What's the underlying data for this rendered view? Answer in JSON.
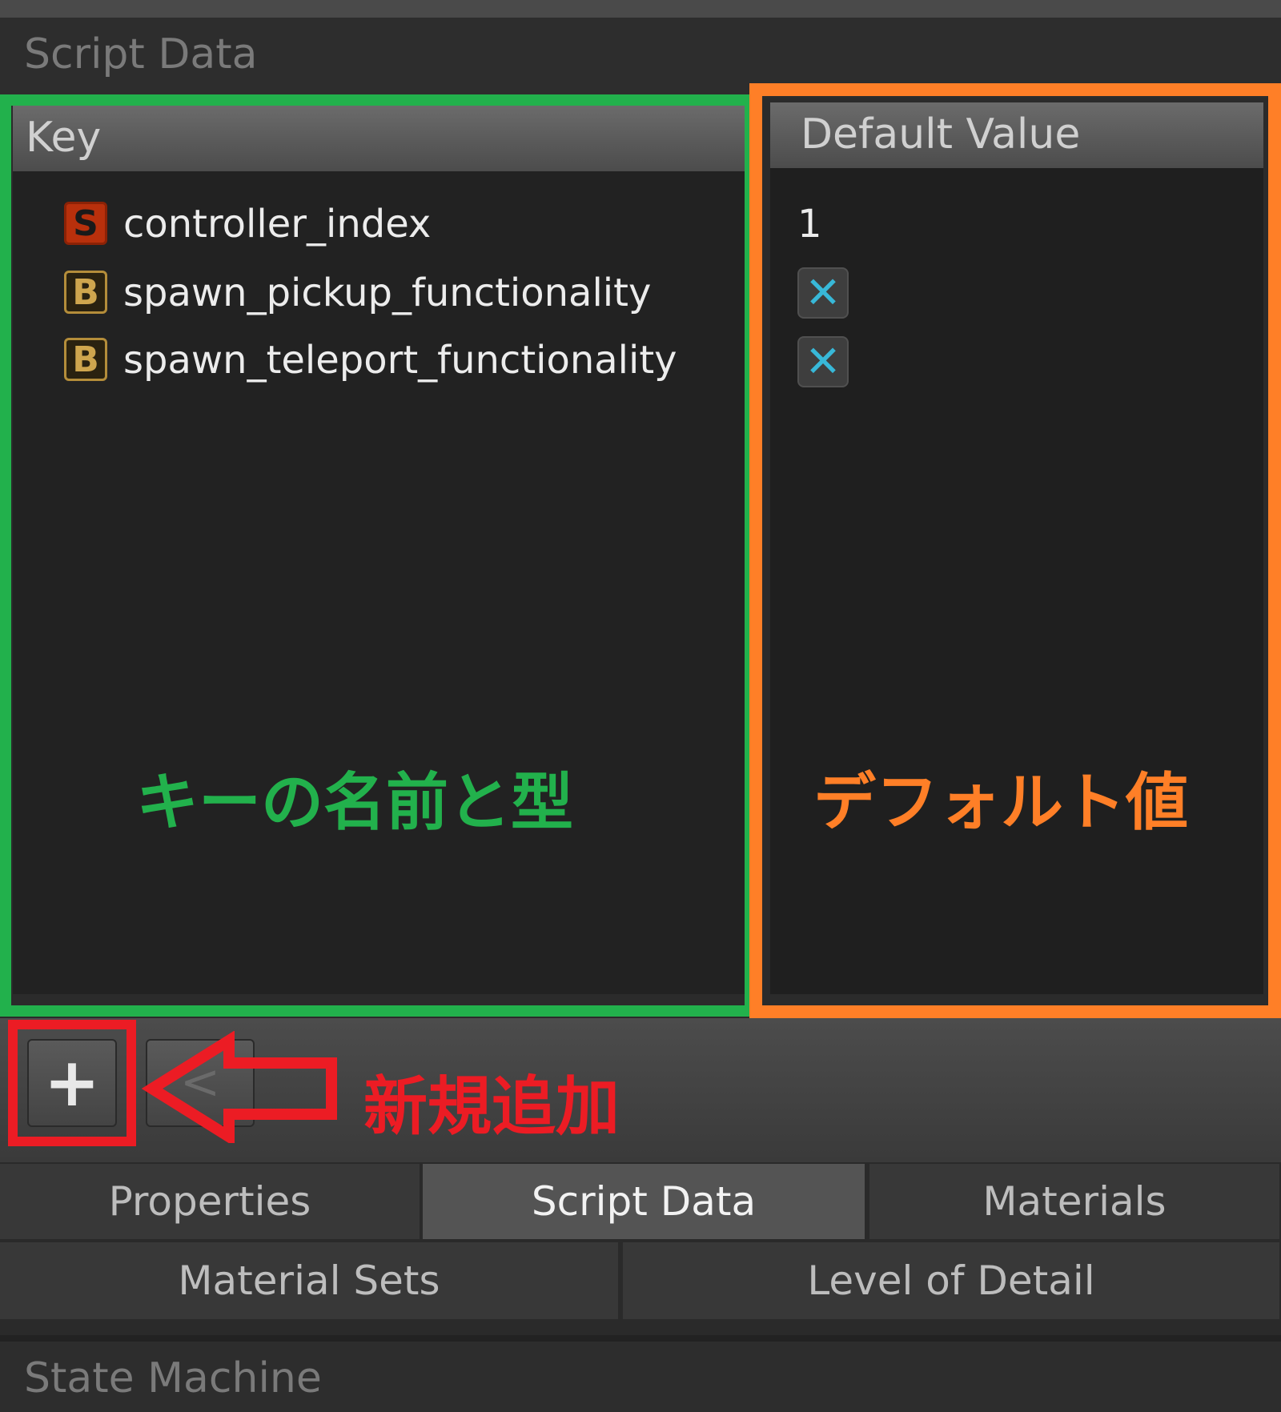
{
  "section": {
    "title": "Script Data"
  },
  "key_column": {
    "header": "Key",
    "rows": [
      {
        "type_letter": "S",
        "name": "controller_index"
      },
      {
        "type_letter": "B",
        "name": "spawn_pickup_functionality"
      },
      {
        "type_letter": "B",
        "name": "spawn_teleport_functionality"
      }
    ]
  },
  "value_column": {
    "header": "Default Value",
    "values": [
      "1",
      "✕",
      "✕"
    ]
  },
  "annotations": {
    "key_label": "キーの名前と型",
    "value_label": "デフォルト値",
    "add_label": "新規追加"
  },
  "toolbar": {
    "add_symbol": "+",
    "back_symbol": "<"
  },
  "tabs_row1": [
    {
      "label": "Properties",
      "active": false
    },
    {
      "label": "Script Data",
      "active": true
    },
    {
      "label": "Materials",
      "active": false
    }
  ],
  "tabs_row2": [
    {
      "label": "Material Sets"
    },
    {
      "label": "Level of Detail"
    }
  ],
  "footer_section": {
    "title": "State Machine"
  },
  "colors": {
    "key_box": "#22b14c",
    "value_box": "#ff7f27",
    "add_box": "#ec1c24"
  }
}
